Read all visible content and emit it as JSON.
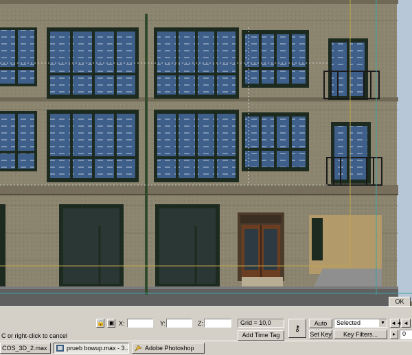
{
  "viewport": {
    "ok_label": "OK"
  },
  "statusbar": {
    "x_label": "X:",
    "y_label": "Y:",
    "z_label": "Z:",
    "x_value": "",
    "y_value": "",
    "z_value": "",
    "grid_text": "Grid = 10,0",
    "add_time_tag": "Add Time Tag",
    "auto_key": "Auto Key",
    "set_key": "Set Key",
    "selected_option": "Selected",
    "key_filters": "Key Filters...",
    "frame_value": "0",
    "prompt": "C or right-click to cancel"
  },
  "taskbar": {
    "items": [
      {
        "label": "COS_3D_2.max ..."
      },
      {
        "label": "prueb bowup.max - 3..."
      },
      {
        "label": "Adobe Photoshop"
      }
    ]
  },
  "colors": {
    "facade": "#8c8570",
    "window_frame": "#1c2a1f",
    "door": "#6b3e22",
    "ui_gray": "#d4d0c8"
  }
}
